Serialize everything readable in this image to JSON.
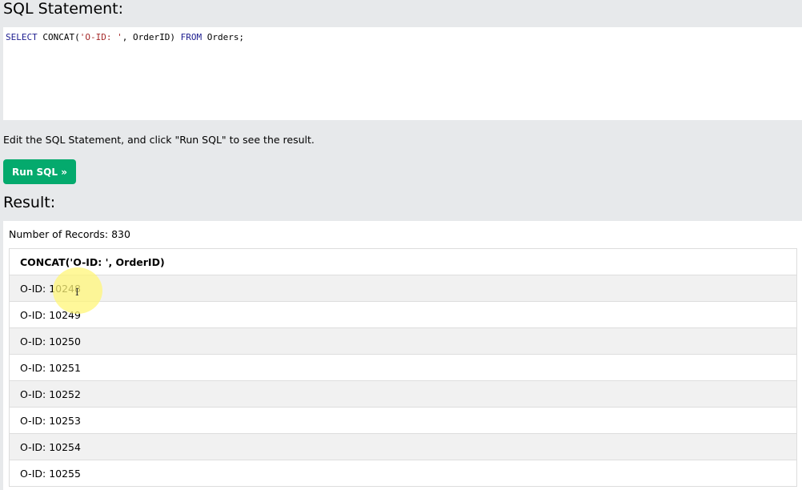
{
  "sql_section": {
    "heading": "SQL Statement:",
    "query": {
      "kw_select": "SELECT",
      "fn_open": " CONCAT(",
      "string_literal": "'O-ID: '",
      "after_string": ", OrderID) ",
      "kw_from": "FROM",
      "table": " Orders;"
    }
  },
  "instructions": "Edit the SQL Statement, and click \"Run SQL\" to see the result.",
  "run_button": {
    "label": "Run SQL »"
  },
  "result_section": {
    "heading": "Result:",
    "records_label": "Number of Records: 830",
    "table": {
      "column_header": "CONCAT('O-ID: ', OrderID)",
      "rows": [
        "O-ID: 10248",
        "O-ID: 10249",
        "O-ID: 10250",
        "O-ID: 10251",
        "O-ID: 10252",
        "O-ID: 10253",
        "O-ID: 10254",
        "O-ID: 10255"
      ]
    }
  },
  "colors": {
    "page_bg": "#e7e9eb",
    "button_bg": "#04aa6d",
    "row_alt": "#f1f1f1"
  },
  "cursor": {
    "icon": "text-ibeam-cursor-icon"
  }
}
